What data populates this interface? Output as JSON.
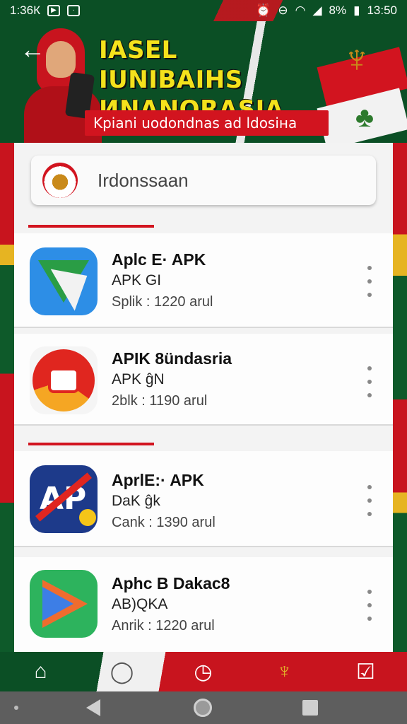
{
  "status_bar": {
    "left_text": "1:36К",
    "time": "13:50",
    "battery": "8%",
    "icons": [
      "video-icon",
      "chat-icon",
      "alarm-icon",
      "dnd-icon",
      "wifi-icon",
      "signal-icon",
      "battery-icon"
    ]
  },
  "header": {
    "title_line1": "IASEL IUNIBAIHS",
    "title_line2": "ИNANORASIA",
    "subtitle": "Kpiani uodondnas ad ldosiна"
  },
  "search": {
    "value": "Irdonssaan"
  },
  "apps": [
    {
      "title": "Aplc E· APK",
      "subtitle": "APK GI",
      "meta": "Splik : 1220 arul",
      "icon": "maps-style-icon"
    },
    {
      "title": "APIK 8ündasria",
      "subtitle": "APK ĝN",
      "meta": "2blk : 1190 arul",
      "icon": "camera-style-icon"
    },
    {
      "title": "AprlE:· APK",
      "subtitle": "DaK ĝk",
      "meta": "Cank : 1390 arul",
      "icon": "ap-style-icon"
    },
    {
      "title": "Aphc B Dakac8",
      "subtitle": "AB)QKA",
      "meta": "Anrik : 1220 arul",
      "icon": "play-style-icon"
    }
  ],
  "bottom_nav": {
    "items": [
      "home-icon",
      "profile-icon",
      "clock-icon",
      "garuda-icon",
      "checklist-icon"
    ],
    "active": "profile-icon"
  },
  "colors": {
    "brand_red": "#d2141f",
    "brand_green": "#0b4f25",
    "title_yellow": "#f4e21c"
  }
}
